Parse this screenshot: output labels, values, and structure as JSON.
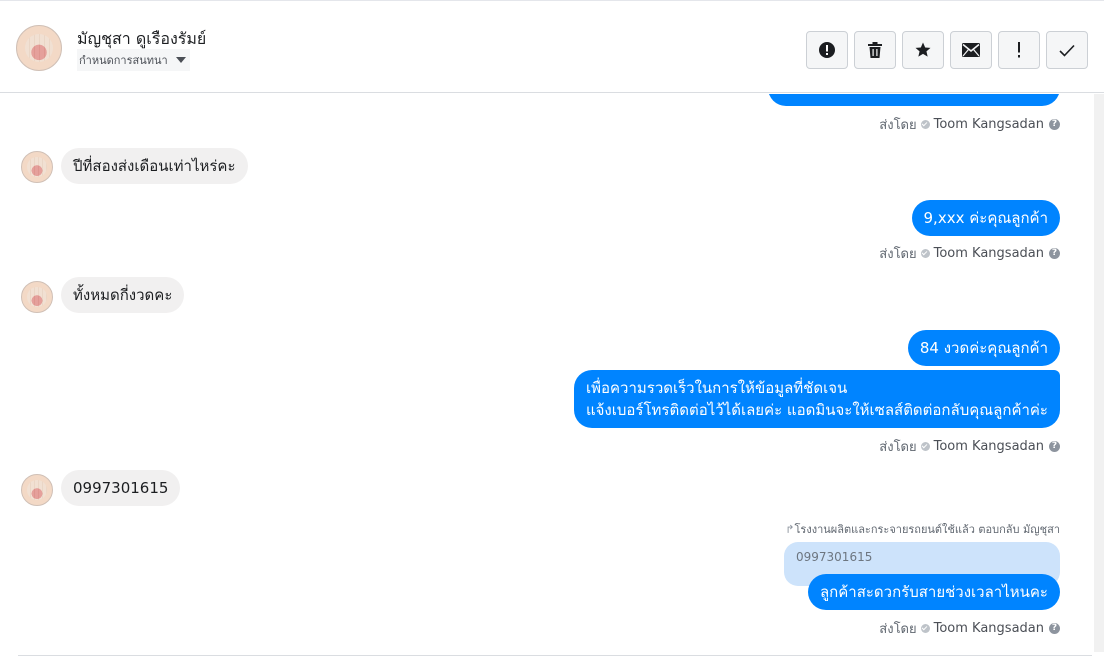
{
  "header": {
    "contact_name": "มัญชุสา ดูเรืองรัมย์",
    "conversation_dropdown": "กำหนดการสนทนา",
    "toolbar_icons": [
      "exclamation-circle-icon",
      "trash-icon",
      "star-icon",
      "envelope-icon",
      "exclamation-icon",
      "checkmark-icon"
    ]
  },
  "thread": {
    "sent_by_prefix": "ส่งโดย",
    "agent_name": "Toom Kangsadan",
    "messages": [
      {
        "from": "customer",
        "text": "ปีที่สองส่งเดือนเท่าไหร่คะ"
      },
      {
        "from": "page",
        "text": "9,xxx ค่ะคุณลูกค้า"
      },
      {
        "from": "customer",
        "text": "ทั้งหมดกี่งวดคะ"
      },
      {
        "from": "page",
        "text": "84 งวดค่ะคุณลูกค้า"
      },
      {
        "from": "page",
        "lines": [
          "เพื่อความรวดเร็วในการให้ข้อมูลที่ชัดเจน",
          "แจ้งเบอร์โทรติดต่อไว้ได้เลยค่ะ แอดมินจะให้เซลส์ติดต่อกลับคุณลูกค้าค่ะ"
        ]
      },
      {
        "from": "customer",
        "text": "0997301615"
      },
      {
        "from": "page",
        "text": "ลูกค้าสะดวกรับสายช่วงเวลาไหนคะ"
      }
    ],
    "reply_note": "โรงงานผลิตและกระจายรถยนต์ใช้แล้ว ตอบกลับ มัญชุสา",
    "quoted_text": "0997301615"
  },
  "colors": {
    "outgoing_bubble": "#0084ff",
    "incoming_bubble": "#f1f0f0",
    "quoted_bubble": "#cde3fb"
  }
}
